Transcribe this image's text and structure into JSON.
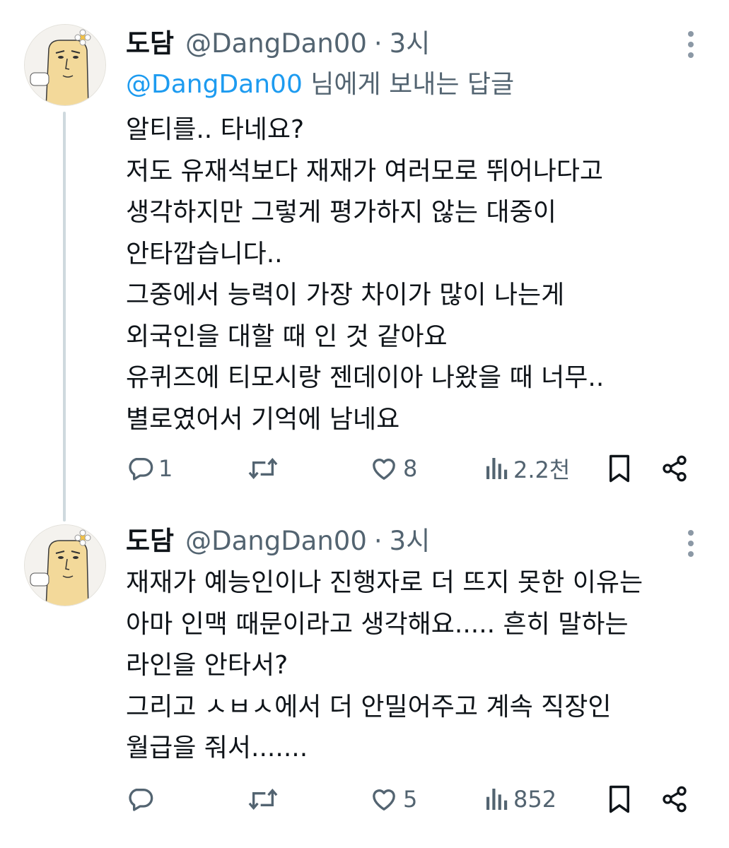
{
  "tweets": [
    {
      "name": "도담",
      "handle": "@DangDan00",
      "separator": "·",
      "time": "3시",
      "replying_to": {
        "mention": "@DangDan00",
        "suffix": " 님에게 보내는 답글"
      },
      "lines": [
        "알티를.. 타네요?",
        "저도 유재석보다 재재가 여러모로 뛰어나다고",
        "생각하지만 그렇게 평가하지 않는 대중이",
        "안타깝습니다..",
        "그중에서 능력이 가장 차이가 많이 나는게",
        "외국인을 대할 때 인 것 같아요",
        "유퀴즈에 티모시랑 젠데이아 나왔을 때 너무..",
        "별로였어서 기억에 남네요"
      ],
      "stats": {
        "replies": "1",
        "retweets": "",
        "likes": "8",
        "views": "2.2천"
      }
    },
    {
      "name": "도담",
      "handle": "@DangDan00",
      "separator": "·",
      "time": "3시",
      "lines": [
        "재재가 예능인이나 진행자로 더 뜨지 못한 이유는",
        "아마 인맥 때문이라고 생각해요..... 흔히 말하는",
        "라인을 안타서?",
        "그리고 ㅅㅂㅅ에서 더 안밀어주고 계속 직장인",
        "월급을 줘서......."
      ],
      "stats": {
        "replies": "",
        "retweets": "",
        "likes": "5",
        "views": "852"
      }
    }
  ],
  "icons": {
    "reply": "reply-icon",
    "retweet": "retweet-icon",
    "like": "heart-icon",
    "views": "views-icon",
    "bookmark": "bookmark-icon",
    "share": "share-icon",
    "more": "more-vertical-icon"
  },
  "colors": {
    "text": "#0f1419",
    "secondary": "#536471",
    "link": "#1d9bf0",
    "thread_line": "#cfd9de"
  }
}
